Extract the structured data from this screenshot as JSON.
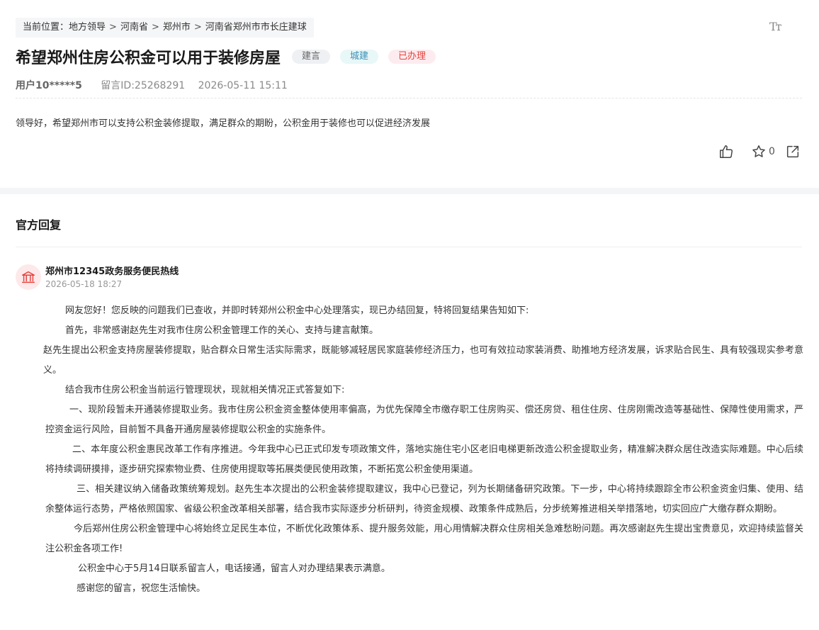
{
  "breadcrumb": {
    "label": "当前位置：",
    "items": [
      "地方领导",
      "河南省",
      "郑州市",
      "河南省郑州市市长庄建球"
    ],
    "separator": ">"
  },
  "font_toggle": {
    "icon": "font-size-icon",
    "text": "Tт"
  },
  "message": {
    "title": "希望郑州住房公积金可以用于装修房屋",
    "tags": [
      {
        "label": "建言",
        "color": "#666666"
      },
      {
        "label": "城建",
        "color": "#3a8fb7"
      },
      {
        "label": "已办理",
        "color": "#e5433f"
      }
    ],
    "user": "用户10*****5",
    "msg_id": "留言ID:25268291",
    "time": "2026-05-11 15:11",
    "content": "领导好，希望郑州市可以支持公积金装修提取，满足群众的期盼，公积金用于装修也可以促进经济发展",
    "favorite_count": "0"
  },
  "reply": {
    "section_title": "官方回复",
    "org_name": "郑州市12345政务服务便民热线",
    "org_time": "2026-05-18 18:27",
    "avatar_icon": "government-building-icon",
    "accent_color": "#e5433f",
    "paragraphs": [
      "网友您好！您反映的问题我们已查收，并即时转郑州公积金中心处理落实，现已办结回复，特将回复结果告知如下:",
      "首先，非常感谢赵先生对我市住房公积金管理工作的关心、支持与建言献策。",
      "赵先生提出公积金支持房屋装修提取，贴合群众日常生活实际需求，既能够减轻居民家庭装修经济压力，也可有效拉动家装消费、助推地方经济发展，诉求贴合民生、具有较强现实参考意义。",
      "结合我市住房公积金当前运行管理现状，现就相关情况正式答复如下:",
      "一、现阶段暂未开通装修提取业务。我市住房公积金资金整体使用率偏高，为优先保障全市缴存职工住房购买、偿还房贷、租住住房、住房刚需改造等基础性、保障性使用需求，严控资金运行风险，目前暂不具备开通房屋装修提取公积金的实施条件。",
      "二、本年度公积金惠民改革工作有序推进。今年我中心已正式印发专项政策文件，落地实施住宅小区老旧电梯更新改造公积金提取业务，精准解决群众居住改造实际难题。中心后续将持续调研摸排，逐步研究探索物业费、住房使用提取等拓展类便民使用政策，不断拓宽公积金使用渠道。",
      "三、相关建议纳入储备政策统筹规划。赵先生本次提出的公积金装修提取建议，我中心已登记，列为长期储备研究政策。下一步，中心将持续跟踪全市公积金资金归集、使用、结余整体运行态势，严格依照国家、省级公积金改革相关部署，结合我市实际逐步分析研判，待资金规模、政策条件成熟后，分步统筹推进相关举措落地，切实回应广大缴存群众期盼。",
      "今后郑州住房公积金管理中心将始终立足民生本位，不断优化政策体系、提升服务效能，用心用情解决群众住房相关急难愁盼问题。再次感谢赵先生提出宝贵意见，欢迎持续监督关注公积金各项工作!",
      "公积金中心于5月14日联系留言人，电话接通，留言人对办理结果表示满意。",
      "感谢您的留言，祝您生活愉快。"
    ]
  }
}
